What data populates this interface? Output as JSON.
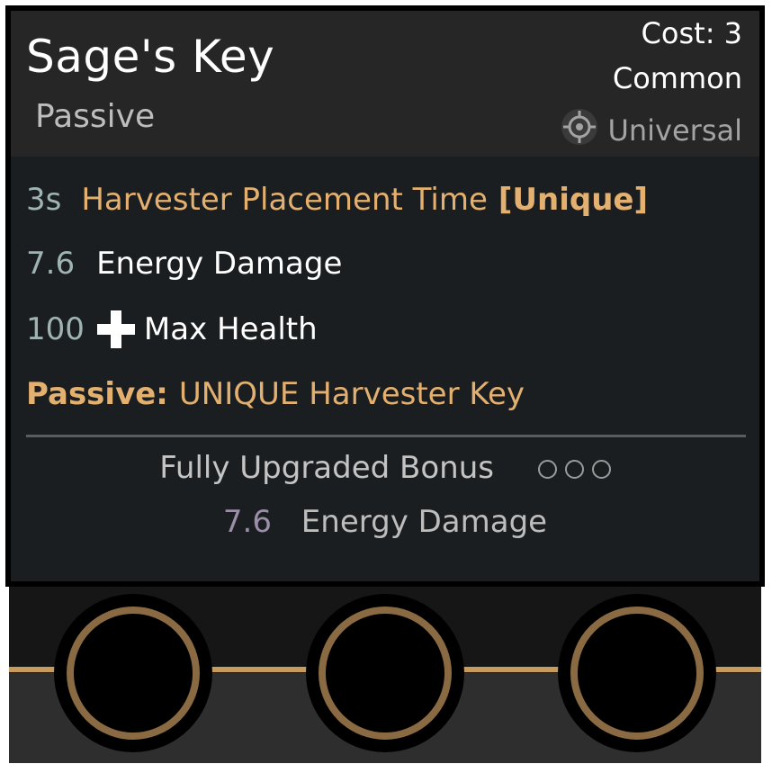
{
  "card": {
    "title": "Sage's Key",
    "type": "Passive",
    "cost": "Cost: 3",
    "rarity": "Common",
    "category": "Universal",
    "category_icon": "crosshair-target-icon"
  },
  "stats": [
    {
      "value": "3s",
      "label": "Harvester Placement Time",
      "tag": "[Unique]"
    },
    {
      "value": "7.6",
      "label": "Energy Damage"
    },
    {
      "value": "100",
      "icon": "plus-health-icon",
      "label": "Max Health"
    }
  ],
  "passive": {
    "prefix": "Passive:",
    "text": "UNIQUE Harvester Key"
  },
  "bonus": {
    "title": "Fully Upgraded Bonus",
    "upgrade_levels_filled": 0,
    "upgrade_levels_total": 3,
    "value": "7.6",
    "label": "Energy Damage"
  },
  "slots": {
    "count": 3,
    "filled": 0
  },
  "colors": {
    "accent_gold": "#e3b06f",
    "stat_number": "#9fb4b2",
    "header_bg": "#262626",
    "body_bg": "#1b1e20",
    "slot_ring": "#8a6a42"
  }
}
